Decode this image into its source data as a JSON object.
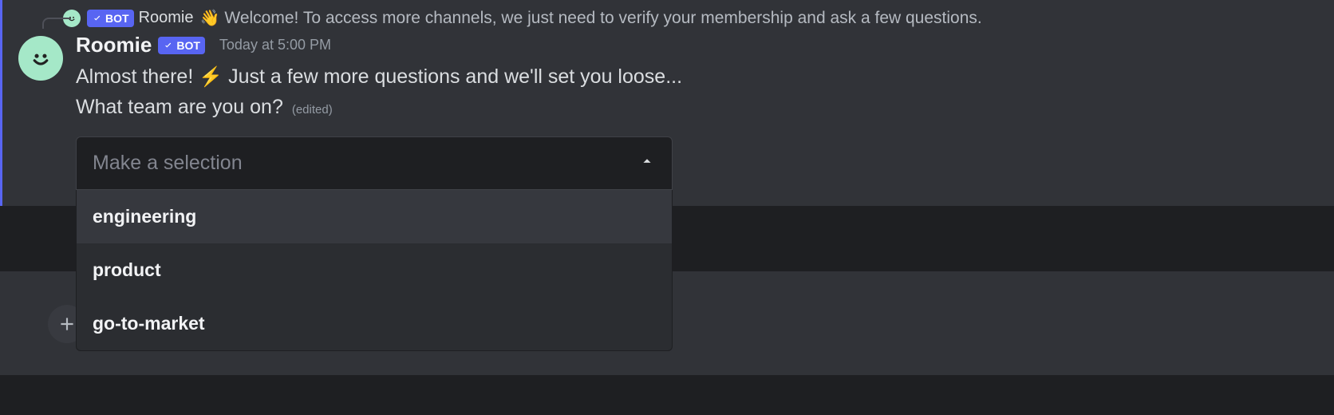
{
  "reply": {
    "username": "Roomie",
    "bot_label": "BOT",
    "wave_emoji": "👋",
    "preview": "Welcome! To access more channels, we just need to verify your membership and ask a few questions."
  },
  "message": {
    "username": "Roomie",
    "bot_label": "BOT",
    "timestamp": "Today at 5:00 PM",
    "line1_pre": "Almost there! ",
    "bolt_emoji": "⚡",
    "line1_post": " Just a few more questions and we'll set you loose...",
    "line2": "What team are you on?",
    "edited_label": "(edited)"
  },
  "select": {
    "placeholder": "Make a selection",
    "options": [
      "engineering",
      "product",
      "go-to-market"
    ]
  }
}
